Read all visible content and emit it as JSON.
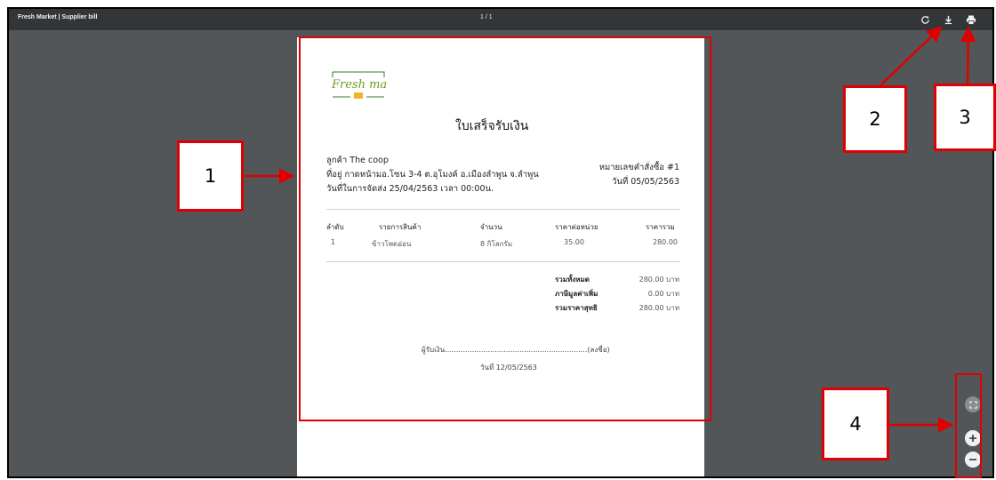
{
  "toolbar": {
    "title": "Fresh Market | Supplier bill",
    "page_indicator": "1 / 1",
    "icons": [
      "rotate-icon",
      "download-icon",
      "print-icon"
    ]
  },
  "logo": {
    "text": "Fresh market"
  },
  "document": {
    "title": "ใบเสร็จรับเงิน",
    "customer": "ลูกค้า The coop",
    "address": "ที่อยู่ กาดหน้ามอ.โซน 3-4 ต.อุโมงค์ อ.เมืองลำพูน จ.ลำพูน",
    "delivery_date": "วันที่ในการจัดส่ง 25/04/2563 เวลา 00:00น.",
    "order_number": "หมายเลขคำสั่งซื้อ #1",
    "order_date": "วันที่ 05/05/2563"
  },
  "table": {
    "headers": [
      "ลำดับ",
      "รายการสินค้า",
      "จำนวน",
      "ราคาต่อหน่วย",
      "ราคารวม"
    ],
    "rows": [
      [
        "1",
        "ข้าวโพดอ่อน",
        "8 กิโลกรัม",
        "35.00",
        "280.00"
      ]
    ]
  },
  "totals": [
    {
      "label": "รวมทั้งหมด",
      "value": "280.00 บาท"
    },
    {
      "label": "ภาษีมูลค่าเพิ่ม",
      "value": "0.00 บาท"
    },
    {
      "label": "รวมราคาสุทธิ",
      "value": "280.00 บาท"
    }
  ],
  "signature": {
    "line": "ผู้รับเงิน...............................................................(ลงชื่อ)",
    "date": "วันที่ 12/05/2563"
  },
  "callouts": [
    "1",
    "2",
    "3",
    "4"
  ],
  "colors": {
    "annotation": "#e00000",
    "viewer_bg": "#525659",
    "toolbar_bg": "#323639"
  }
}
